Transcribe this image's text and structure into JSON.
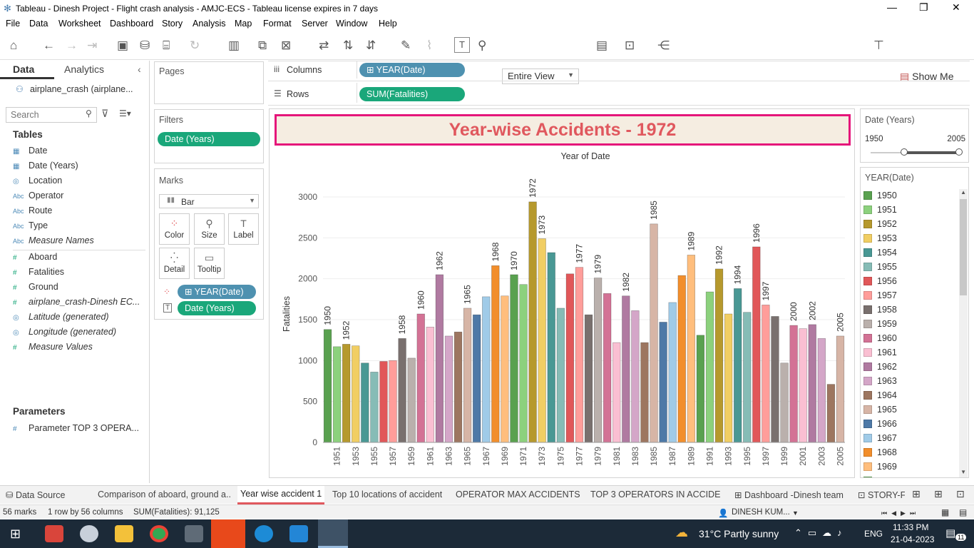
{
  "window": {
    "title": "Tableau - Dinesh Project - Flight crash analysis - AMJC-ECS - Tableau license expires in 7 days"
  },
  "menu": [
    "File",
    "Data",
    "Worksheet",
    "Dashboard",
    "Story",
    "Analysis",
    "Map",
    "Format",
    "Server",
    "Window",
    "Help"
  ],
  "toolbar": {
    "view_mode": "Entire View",
    "show_me": "Show Me"
  },
  "left": {
    "tab_data": "Data",
    "tab_analytics": "Analytics",
    "datasource": "airplane_crash (airplane...",
    "search_placeholder": "Search",
    "tables_header": "Tables",
    "fields": [
      {
        "icon": "calendar-icon",
        "glyph": "▦",
        "label": "Date",
        "italic": false
      },
      {
        "icon": "calendar-icon",
        "glyph": "▦",
        "label": "Date (Years)",
        "italic": false
      },
      {
        "icon": "globe-icon",
        "glyph": "◎",
        "label": "Location",
        "italic": false
      },
      {
        "icon": "abc-icon",
        "glyph": "Abc",
        "label": "Operator",
        "italic": false
      },
      {
        "icon": "abc-icon",
        "glyph": "Abc",
        "label": "Route",
        "italic": false
      },
      {
        "icon": "abc-icon",
        "glyph": "Abc",
        "label": "Type",
        "italic": false
      },
      {
        "icon": "abc-icon",
        "glyph": "Abc",
        "label": "Measure Names",
        "italic": true
      },
      {
        "icon": "hash-icon",
        "glyph": "#",
        "label": "Aboard",
        "italic": false
      },
      {
        "icon": "hash-icon",
        "glyph": "#",
        "label": "Fatalities",
        "italic": false
      },
      {
        "icon": "hash-icon",
        "glyph": "#",
        "label": "Ground",
        "italic": false
      },
      {
        "icon": "hash-icon",
        "glyph": "#",
        "label": "airplane_crash-Dinesh EC...",
        "italic": true
      },
      {
        "icon": "globe-icon",
        "glyph": "◎",
        "label": "Latitude (generated)",
        "italic": true
      },
      {
        "icon": "globe-icon",
        "glyph": "◎",
        "label": "Longitude (generated)",
        "italic": true
      },
      {
        "icon": "hash-icon",
        "glyph": "#",
        "label": "Measure Values",
        "italic": true
      }
    ],
    "parameters_header": "Parameters",
    "parameter": "Parameter TOP 3 OPERA..."
  },
  "shelves": {
    "pages": "Pages",
    "filters": "Filters",
    "filter_pill": "Date (Years)",
    "marks": "Marks",
    "mark_type": "Bar",
    "mark_buttons": [
      "Color",
      "Size",
      "Label",
      "Detail",
      "Tooltip"
    ],
    "mark_pill_color": "YEAR(Date)",
    "mark_pill_label": "Date (Years)",
    "columns_label": "Columns",
    "columns_pill": "YEAR(Date)",
    "rows_label": "Rows",
    "rows_pill": "SUM(Fatalities)"
  },
  "viz": {
    "title": "Year-wise Accidents - 1972"
  },
  "filter_card": {
    "title": "Date (Years)",
    "min": "1950",
    "max": "2005"
  },
  "legend": {
    "title": "YEAR(Date)"
  },
  "chart_data": {
    "type": "bar",
    "title": "Year of Date",
    "ylabel": "Fatalities",
    "ylim": [
      0,
      3200
    ],
    "yticks": [
      0,
      500,
      1000,
      1500,
      2000,
      2500,
      3000
    ],
    "categories": [
      "1950",
      "1951",
      "1952",
      "1953",
      "1954",
      "1955",
      "1956",
      "1957",
      "1958",
      "1959",
      "1960",
      "1961",
      "1962",
      "1963",
      "1964",
      "1965",
      "1966",
      "1967",
      "1968",
      "1969",
      "1970",
      "1971",
      "1972",
      "1973",
      "1974",
      "1975",
      "1976",
      "1977",
      "1978",
      "1979",
      "1980",
      "1981",
      "1982",
      "1983",
      "1984",
      "1985",
      "1986",
      "1987",
      "1988",
      "1989",
      "1990",
      "1991",
      "1992",
      "1993",
      "1994",
      "1995",
      "1996",
      "1997",
      "1998",
      "1999",
      "2000",
      "2001",
      "2002",
      "2003",
      "2004",
      "2005"
    ],
    "x_tick_labels": [
      "1951",
      "1953",
      "1955",
      "1957",
      "1959",
      "1961",
      "1963",
      "1965",
      "1967",
      "1969",
      "1971",
      "1973",
      "1975",
      "1977",
      "1979",
      "1981",
      "1983",
      "1985",
      "1987",
      "1989",
      "1991",
      "1993",
      "1995",
      "1997",
      "1999",
      "2001",
      "2003",
      "2005"
    ],
    "values": [
      1380,
      1170,
      1200,
      1180,
      970,
      860,
      990,
      1000,
      1270,
      1030,
      1570,
      1410,
      2050,
      1300,
      1350,
      1640,
      1560,
      1780,
      2160,
      1790,
      2050,
      1930,
      2940,
      2490,
      2320,
      1640,
      2060,
      2140,
      1560,
      2010,
      1820,
      1220,
      1790,
      1610,
      1220,
      2670,
      1470,
      1710,
      2040,
      2290,
      1310,
      1840,
      2120,
      1570,
      1880,
      1590,
      2390,
      1680,
      1540,
      970,
      1430,
      1390,
      1440,
      1270,
      710,
      1300
    ],
    "labeled_years": [
      "1950",
      "1952",
      "1958",
      "1960",
      "1962",
      "1965",
      "1968",
      "1970",
      "1972",
      "1973",
      "1977",
      "1979",
      "1982",
      "1985",
      "1989",
      "1992",
      "1994",
      "1996",
      "1997",
      "2000",
      "2002",
      "2005"
    ],
    "colors": [
      "#59a14f",
      "#8cd17d",
      "#b6992d",
      "#f1ce63",
      "#499894",
      "#86bcb6",
      "#e15759",
      "#ff9d9a",
      "#79706e",
      "#bab0ac",
      "#d37295",
      "#fabfd2",
      "#b07aa1",
      "#d4a6c8",
      "#9d7660",
      "#d7b5a6",
      "#4e79a7",
      "#a0cbe8",
      "#f28e2b",
      "#ffbe7d",
      "#59a14f",
      "#8cd17d",
      "#b6992d",
      "#f1ce63",
      "#499894",
      "#86bcb6",
      "#e15759",
      "#ff9d9a",
      "#79706e",
      "#bab0ac",
      "#d37295",
      "#fabfd2",
      "#b07aa1",
      "#d4a6c8",
      "#9d7660",
      "#d7b5a6",
      "#4e79a7",
      "#a0cbe8",
      "#f28e2b",
      "#ffbe7d",
      "#59a14f",
      "#8cd17d",
      "#b6992d",
      "#f1ce63",
      "#499894",
      "#86bcb6",
      "#e15759",
      "#ff9d9a",
      "#79706e",
      "#bab0ac",
      "#d37295",
      "#fabfd2",
      "#b07aa1",
      "#d4a6c8",
      "#9d7660",
      "#d7b5a6"
    ]
  },
  "sheet_tabs": [
    "Data Source",
    "Comparison of aboard, ground a...",
    "Year wise accident 1",
    "Top 10 locations of accident",
    "OPERATOR  MAX ACCIDENTS",
    "TOP 3 OPERATORS IN ACCIDE...",
    "Dashboard -Dinesh team",
    "STORY-F"
  ],
  "status": {
    "marks": "56 marks",
    "rowscols": "1 row by 56 columns",
    "sum": "SUM(Fatalities): 91,125",
    "user": "DINESH KUM..."
  },
  "taskbar": {
    "weather": "31°C  Partly sunny",
    "lang": "ENG",
    "time": "11:33 PM",
    "date": "21-04-2023",
    "notif": "11"
  }
}
